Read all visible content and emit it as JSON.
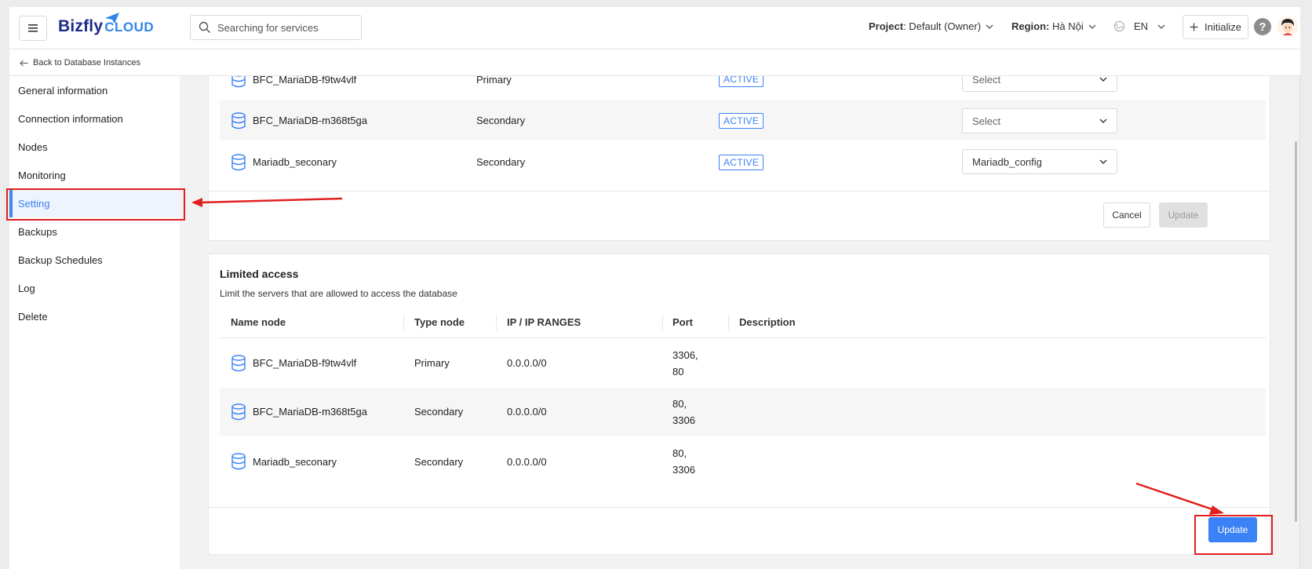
{
  "header": {
    "logo_main": "Bizfly",
    "logo_sub": "CLOUD",
    "search_placeholder": "Searching for services",
    "project_label": "Project",
    "project_value": ": Default (Owner)",
    "region_label": "Region:",
    "region_value": "Hà Nội",
    "language": "EN",
    "initialize_label": "Initialize",
    "help_glyph": "?"
  },
  "subheader": {
    "back_label": "Back to Database Instances"
  },
  "sidebar": {
    "items": [
      {
        "label": "General information"
      },
      {
        "label": "Connection information"
      },
      {
        "label": "Nodes"
      },
      {
        "label": "Monitoring"
      },
      {
        "label": "Setting",
        "active": true
      },
      {
        "label": "Backups"
      },
      {
        "label": "Backup Schedules"
      },
      {
        "label": "Log"
      },
      {
        "label": "Delete"
      }
    ]
  },
  "config_card": {
    "rows": [
      {
        "name": "BFC_MariaDB-f9tw4vlf",
        "type": "Primary",
        "status": "ACTIVE",
        "config": "Select"
      },
      {
        "name": "BFC_MariaDB-m368t5ga",
        "type": "Secondary",
        "status": "ACTIVE",
        "config": "Select"
      },
      {
        "name": "Mariadb_seconary",
        "type": "Secondary",
        "status": "ACTIVE",
        "config": "Mariadb_config"
      }
    ],
    "cancel_label": "Cancel",
    "update_label": "Update"
  },
  "limited_access": {
    "title": "Limited access",
    "description": "Limit the servers that are allowed to access the database",
    "columns": [
      "Name node",
      "Type node",
      "IP / IP RANGES",
      "Port",
      "Description"
    ],
    "rows": [
      {
        "name": "BFC_MariaDB-f9tw4vlf",
        "type": "Primary",
        "ip": "0.0.0.0/0",
        "port_1": "3306,",
        "port_2": "80",
        "description": ""
      },
      {
        "name": "BFC_MariaDB-m368t5ga",
        "type": "Secondary",
        "ip": "0.0.0.0/0",
        "port_1": "80,",
        "port_2": "3306",
        "description": ""
      },
      {
        "name": "Mariadb_seconary",
        "type": "Secondary",
        "ip": "0.0.0.0/0",
        "port_1": "80,",
        "port_2": "3306",
        "description": ""
      }
    ],
    "update_label": "Update"
  },
  "colors": {
    "accent": "#3b82f6",
    "annotation": "#e02020",
    "logo_dark": "#1d2a8a",
    "logo_light": "#2e86e8"
  }
}
